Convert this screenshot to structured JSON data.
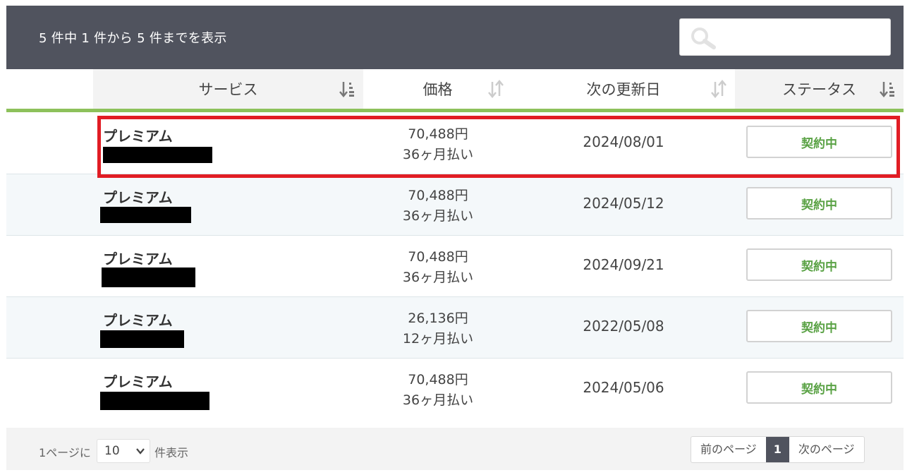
{
  "header": {
    "info_text": "5 件中 1 件から 5 件までを表示",
    "search_placeholder": ""
  },
  "columns": [
    {
      "label": "サービス"
    },
    {
      "label": "価格"
    },
    {
      "label": "次の更新日"
    },
    {
      "label": "ステータス"
    }
  ],
  "rows": [
    {
      "service": "プレミアム",
      "price": "70,488円",
      "term": "36ヶ月払い",
      "next_renewal": "2024/08/01",
      "status": "契約中"
    },
    {
      "service": "プレミアム",
      "price": "70,488円",
      "term": "36ヶ月払い",
      "next_renewal": "2024/05/12",
      "status": "契約中"
    },
    {
      "service": "プレミアム",
      "price": "70,488円",
      "term": "36ヶ月払い",
      "next_renewal": "2024/09/21",
      "status": "契約中"
    },
    {
      "service": "プレミアム",
      "price": "26,136円",
      "term": "12ヶ月払い",
      "next_renewal": "2022/05/08",
      "status": "契約中"
    },
    {
      "service": "プレミアム",
      "price": "70,488円",
      "term": "36ヶ月払い",
      "next_renewal": "2024/05/06",
      "status": "契約中"
    }
  ],
  "footer": {
    "per_page_prefix": "1ページに",
    "per_page_value": "10",
    "per_page_suffix": "件表示",
    "prev_label": "前のページ",
    "current_page": "1",
    "next_label": "次のページ"
  },
  "colors": {
    "header_bg": "#50535e",
    "accent_green": "#8dc15b",
    "status_green": "#5aa245",
    "highlight_red": "#e11d24"
  },
  "icons": {
    "search": "search-icon",
    "sort": "sort-icon",
    "dropdown": "chevron-down-icon"
  }
}
